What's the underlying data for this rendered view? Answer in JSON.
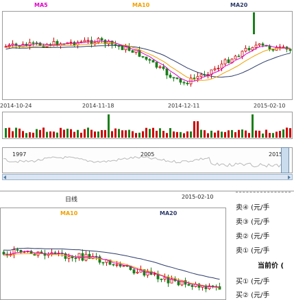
{
  "top_chart": {
    "legend": [
      {
        "label": "MA5",
        "color": "#e000c8"
      },
      {
        "label": "MA10",
        "color": "#f0a000"
      },
      {
        "label": "MA20",
        "color": "#2b3a6a"
      }
    ],
    "dates": [
      "2014-10-24",
      "2014-11-18",
      "2014-12-11",
      "2015-02-10"
    ],
    "up_color": "#cc0000",
    "down_color": "#1a7f1a",
    "navigator_years": [
      "1997",
      "2005",
      "2015"
    ]
  },
  "lower_panel": {
    "title": "日线",
    "date": "2015-02-10",
    "legend": [
      {
        "label": "MA10",
        "color": "#f0a000"
      },
      {
        "label": "MA20",
        "color": "#2b3a6a"
      }
    ]
  },
  "order_book": {
    "rows": [
      "卖④ (元/手",
      "卖③ (元/手",
      "卖② (元/手",
      "卖① (元/手"
    ],
    "current_price_label": "当前价 (",
    "buy_rows": [
      "买① (元/手",
      "买② (元/手"
    ]
  },
  "chart_data": {
    "type": "candlestick",
    "x": [
      "2014-10-24",
      "2014-11-18",
      "2014-12-11",
      "2015-02-10"
    ],
    "series": [
      "MA5",
      "MA10",
      "MA20"
    ]
  }
}
